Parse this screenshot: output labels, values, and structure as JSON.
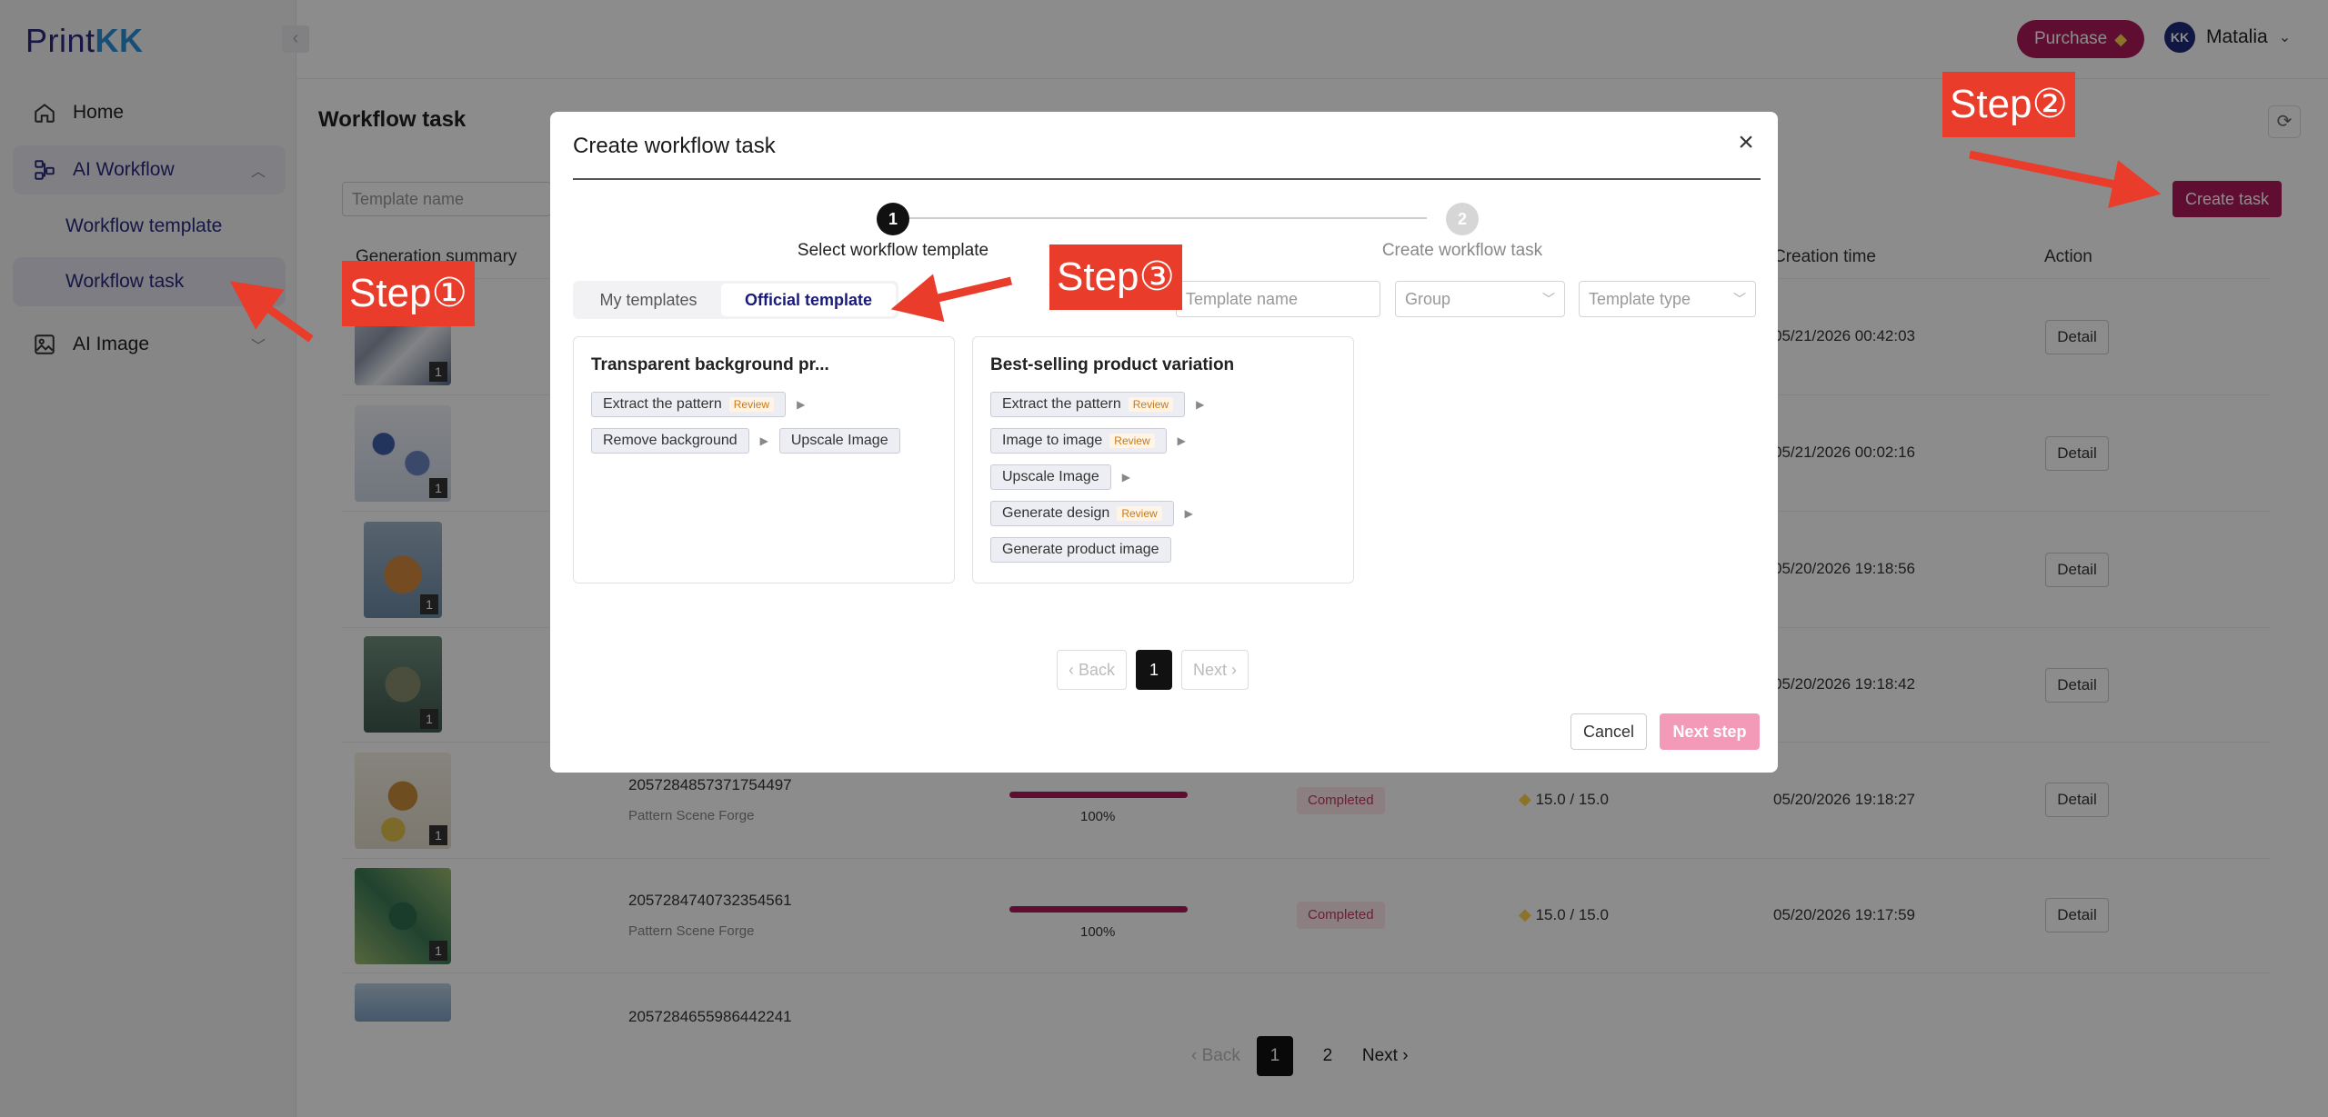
{
  "brand": {
    "logo_part1": "Print",
    "logo_part2": "KK"
  },
  "sidebar": {
    "home": "Home",
    "ai_workflow": "AI Workflow",
    "workflow_template": "Workflow template",
    "workflow_task": "Workflow task",
    "ai_image": "AI Image"
  },
  "header": {
    "purchase": "Purchase",
    "user_initials": "KK",
    "user_name": "Matalia"
  },
  "page": {
    "title": "Workflow task",
    "search_placeholder": "Template name",
    "create_task": "Create task",
    "columns": {
      "summary": "Generation summary",
      "creation_time": "Creation time",
      "action": "Action"
    },
    "rows": [
      {
        "id": "",
        "sub": "",
        "progress": "",
        "status": "",
        "credits": "",
        "time": "05/21/2026 00:42:03",
        "count": "1"
      },
      {
        "id": "",
        "sub": "",
        "progress": "",
        "status": "",
        "credits": "",
        "time": "05/21/2026 00:02:16",
        "count": "1"
      },
      {
        "id": "",
        "sub": "",
        "progress": "",
        "status": "",
        "credits": "",
        "time": "05/20/2026 19:18:56",
        "count": "1"
      },
      {
        "id": "",
        "sub": "",
        "progress": "",
        "status": "",
        "credits": "",
        "time": "05/20/2026 19:18:42",
        "count": "1"
      },
      {
        "id": "2057284857371754497",
        "sub": "Pattern Scene Forge",
        "progress": "100%",
        "status": "Completed",
        "credits": "15.0 / 15.0",
        "time": "05/20/2026 19:18:27",
        "count": "1"
      },
      {
        "id": "2057284740732354561",
        "sub": "Pattern Scene Forge",
        "progress": "100%",
        "status": "Completed",
        "credits": "15.0 / 15.0",
        "time": "05/20/2026 19:17:59",
        "count": "1"
      },
      {
        "id": "2057284655986442241",
        "sub": "",
        "progress": "",
        "status": "",
        "credits": "",
        "time": "",
        "count": ""
      }
    ],
    "detail": "Detail",
    "pager": {
      "back": "Back",
      "p1": "1",
      "p2": "2",
      "next": "Next"
    }
  },
  "modal": {
    "title": "Create workflow task",
    "close": "×",
    "step1_num": "1",
    "step1_label": "Select workflow template",
    "step2_num": "2",
    "step2_label": "Create workflow task",
    "tab_mine": "My templates",
    "tab_official": "Official template",
    "filter_name": "Template name",
    "filter_group": "Group",
    "filter_type": "Template type",
    "card1": {
      "title": "Transparent background pr...",
      "chips": [
        "Extract the pattern",
        "Remove background",
        "Upscale Image"
      ]
    },
    "card2": {
      "title": "Best-selling product variation",
      "chips": [
        "Extract the pattern",
        "Image to image",
        "Upscale Image",
        "Generate design",
        "Generate product image"
      ]
    },
    "review": "Review",
    "pager": {
      "back": "Back",
      "p1": "1",
      "next": "Next"
    },
    "cancel": "Cancel",
    "next_step": "Next step"
  },
  "annotations": {
    "step1": "Step①",
    "step2": "Step②",
    "step3": "Step③"
  },
  "colors": {
    "brand": "#b0195c",
    "annotation": "#ea3c2a",
    "navy": "#2a2a7e"
  }
}
